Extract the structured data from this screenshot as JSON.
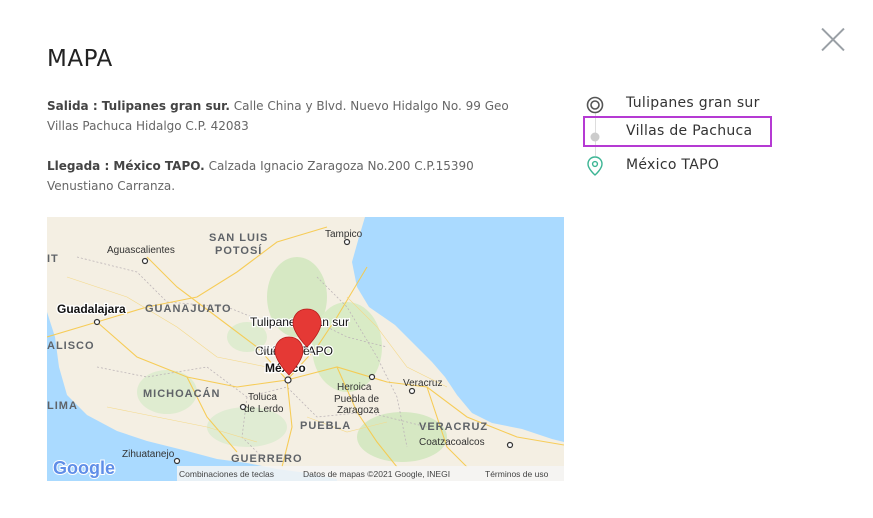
{
  "modal": {
    "title": "MAPA",
    "close_icon": "close-icon"
  },
  "departure": {
    "label": "Salida : Tulipanes gran sur.",
    "address": "Calle China y Blvd. Nuevo Hidalgo No. 99 Geo Villas Pachuca Hidalgo C.P. 42083"
  },
  "arrival": {
    "label": "Llegada : México TAPO.",
    "address": "Calzada Ignacio Zaragoza No.200 C.P.15390 Venustiano Carranza."
  },
  "stops": [
    {
      "label": "Tulipanes gran sur",
      "icon": "origin-ring-icon"
    },
    {
      "label": "Villas de Pachuca",
      "icon": "intermediate-dot-icon"
    },
    {
      "label": "México TAPO",
      "icon": "destination-pin-icon"
    }
  ],
  "highlight_color": "#b53ad3",
  "map": {
    "labels": {
      "san_luis": "SAN LUIS",
      "potosi": "POTOSÍ",
      "tampico": "Tampico",
      "aguascalientes": "Aguascalientes",
      "it": "IT",
      "guadalajara": "Guadalajara",
      "guanajuato": "GUANAJUATO",
      "tulipanes": "Tulipanes gran sur",
      "alisco": "ALISCO",
      "mexico_tapo": "México TAPO",
      "ciudad_de": "Ciudad de",
      "mexico": "México",
      "heroica": "Heroica",
      "puebla_de": "Puebla de",
      "zaragoza": "Zaragoza",
      "veracruz": "Veracruz",
      "michoacan": "MICHOACÁN",
      "lima": "LIMA",
      "toluca": "Toluca",
      "de_lerdo": "de Lerdo",
      "puebla": "PUEBLA",
      "coatzacoalcos": "Coatzacoalcos",
      "veracruz_state": "VERACRUZ",
      "zihuatanejo": "Zihuatanejo",
      "guerrero": "GUERRERO"
    },
    "footer": {
      "shortcuts": "Combinaciones de teclas",
      "data": "Datos de mapas ©2021 Google, INEGI",
      "terms": "Términos de uso"
    },
    "logo": "Google",
    "marker_color": "#e53935",
    "water_color": "#aadaff"
  }
}
